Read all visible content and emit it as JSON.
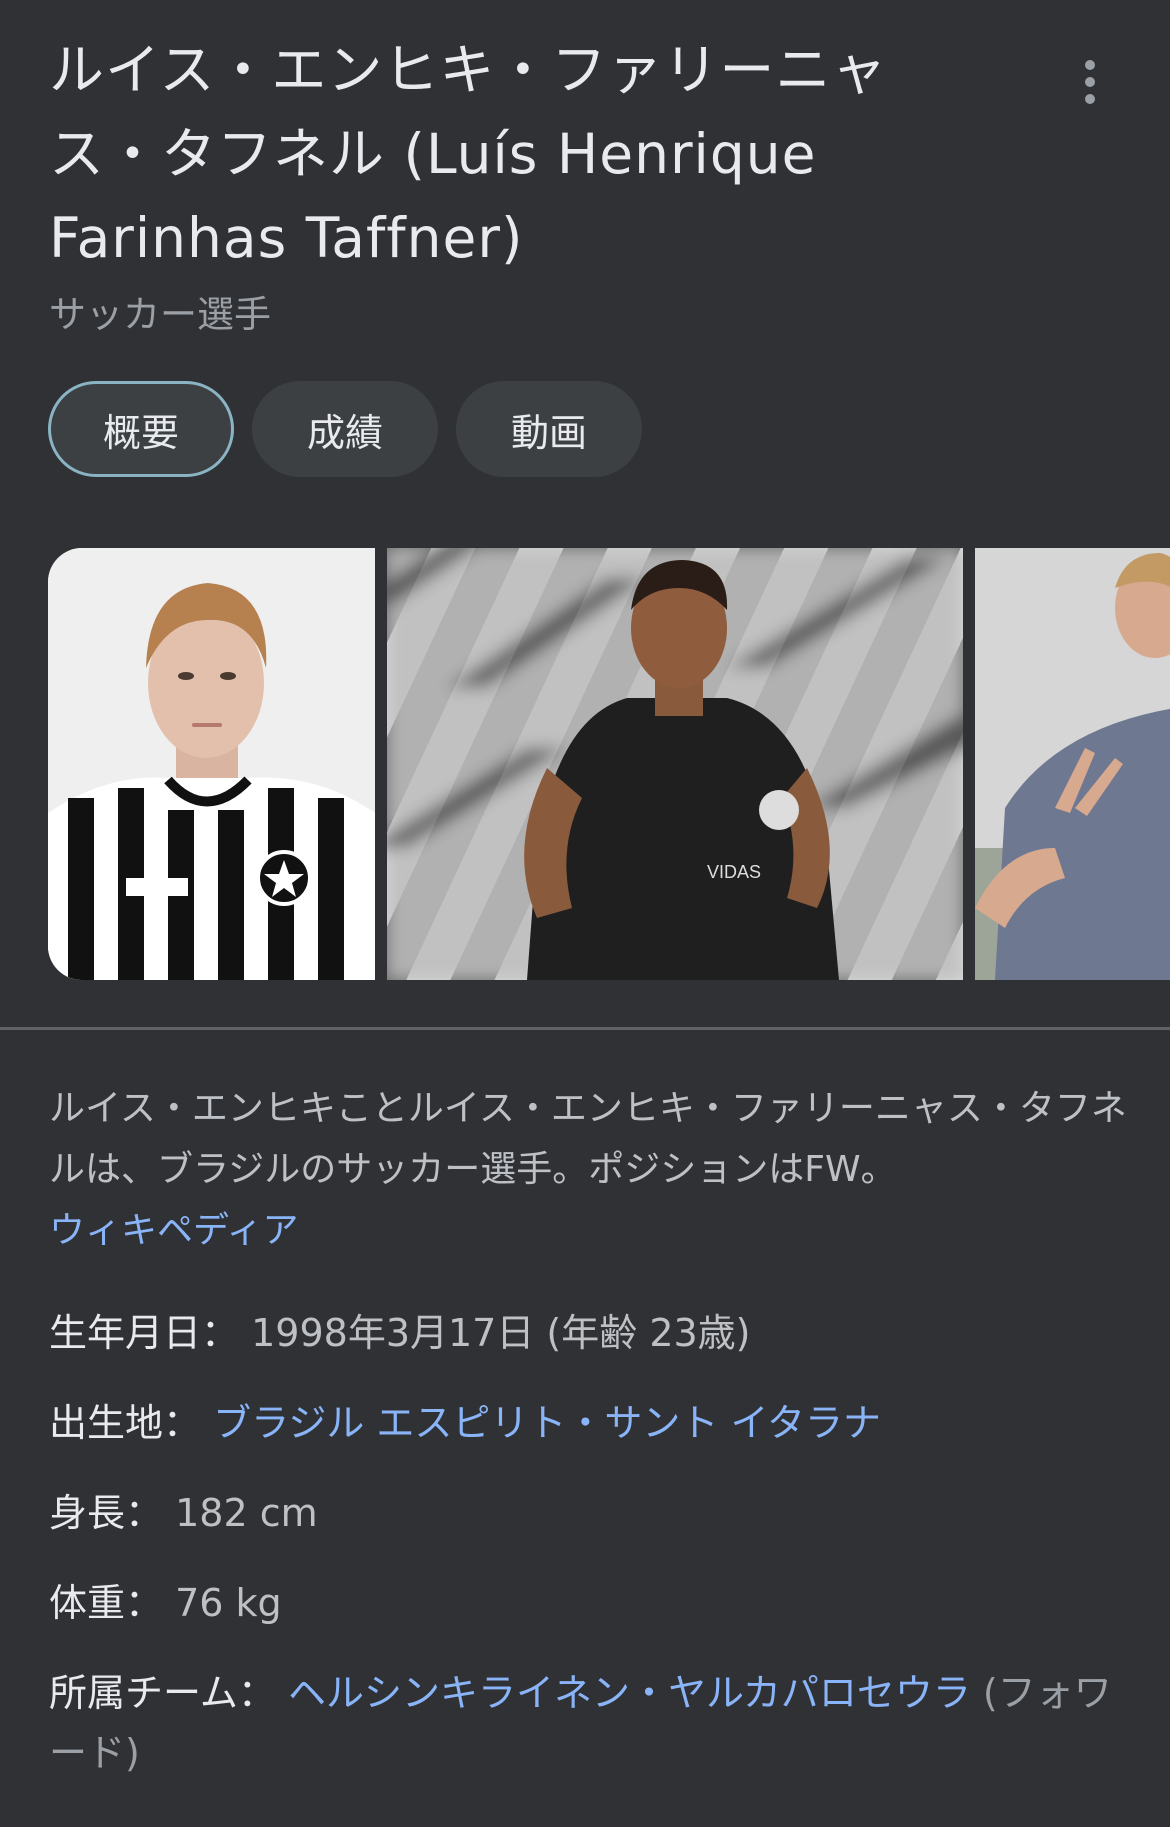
{
  "header": {
    "title": "ルイス・エンヒキ・ファリーニャ\nス・タフネル (Luís Henrique\nFarinhas Taffner)",
    "subtitle": "サッカー選手"
  },
  "more_icon": "more-vert-icon",
  "tabs": [
    {
      "label": "概要",
      "active": true
    },
    {
      "label": "成績",
      "active": false
    },
    {
      "label": "動画",
      "active": false
    }
  ],
  "description": {
    "text": "ルイス・エンヒキことルイス・エンヒキ・ファリーニャス・タフネルは、ブラジルのサッカー選手。ポジションはFW。",
    "source_link": "ウィキペディア"
  },
  "facts": {
    "birth": {
      "label": "生年月日：",
      "value": "1998年3月17日 (年齢 23歳)"
    },
    "birthplace": {
      "label": "出生地：",
      "value": "ブラジル エスピリト・サント イタラナ"
    },
    "height": {
      "label": "身長：",
      "value": "182 cm"
    },
    "weight": {
      "label": "体重：",
      "value": "76 kg"
    },
    "team": {
      "label": "所属チーム：",
      "value": "ヘルシンキライネン・ヤルカパロセウラ",
      "extra": " (フォワード)"
    }
  },
  "colors": {
    "background": "#303134",
    "link": "#8ab4f8",
    "text": "#e8eaed",
    "muted": "#bdc1c6"
  }
}
